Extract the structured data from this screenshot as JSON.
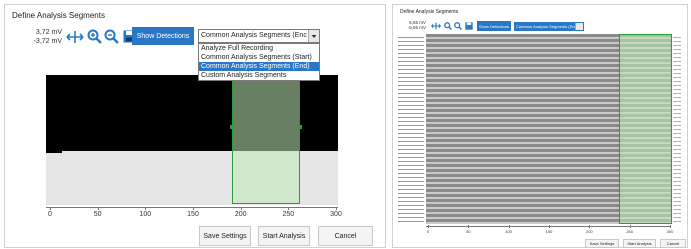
{
  "left": {
    "title": "Define Analysis Segments",
    "gain_top": "3,72 mV",
    "gain_bottom": "-3,72 mV",
    "show_detections_label": "Show Detections",
    "dropdown_value": "Common Analysis Segments (Enc",
    "dropdown_options": [
      "Analyze Full Recording",
      "Common Analysis Segments (Start)",
      "Common Analysis Segments (End)",
      "Custom Analysis Segments"
    ],
    "selected_option_index": 2,
    "x_ticks": [
      "0",
      "50",
      "100",
      "150",
      "200",
      "250",
      "300"
    ],
    "save_settings_label": "Save Settings",
    "start_analysis_label": "Start Analysis",
    "cancel_label": "Cancel"
  },
  "right": {
    "title": "Define Analysis Segments",
    "gain_top": "5,65 mV",
    "gain_bottom": "-5,65 mV",
    "show_detections_label": "Show Detections",
    "dropdown_value": "Common Analysis Segments (Enc",
    "x_ticks": [
      "0",
      "50",
      "100",
      "150",
      "200",
      "250",
      "300"
    ],
    "save_settings_label": "Save Settings",
    "start_analysis_label": "Start Analysis",
    "cancel_label": "Cancel"
  },
  "icons": {
    "move": "move-arrows-icon",
    "zoom_in": "zoom-in-icon",
    "zoom_out": "zoom-out-icon",
    "save": "save-disk-icon"
  },
  "colors": {
    "accent": "#2a78c5",
    "segment_fill": "#bfe7b5",
    "segment_border": "#2e9a3a",
    "plot_dark": "#000000",
    "plot_light": "#e6e6e6",
    "grid_gray": "#8a8a8a"
  }
}
